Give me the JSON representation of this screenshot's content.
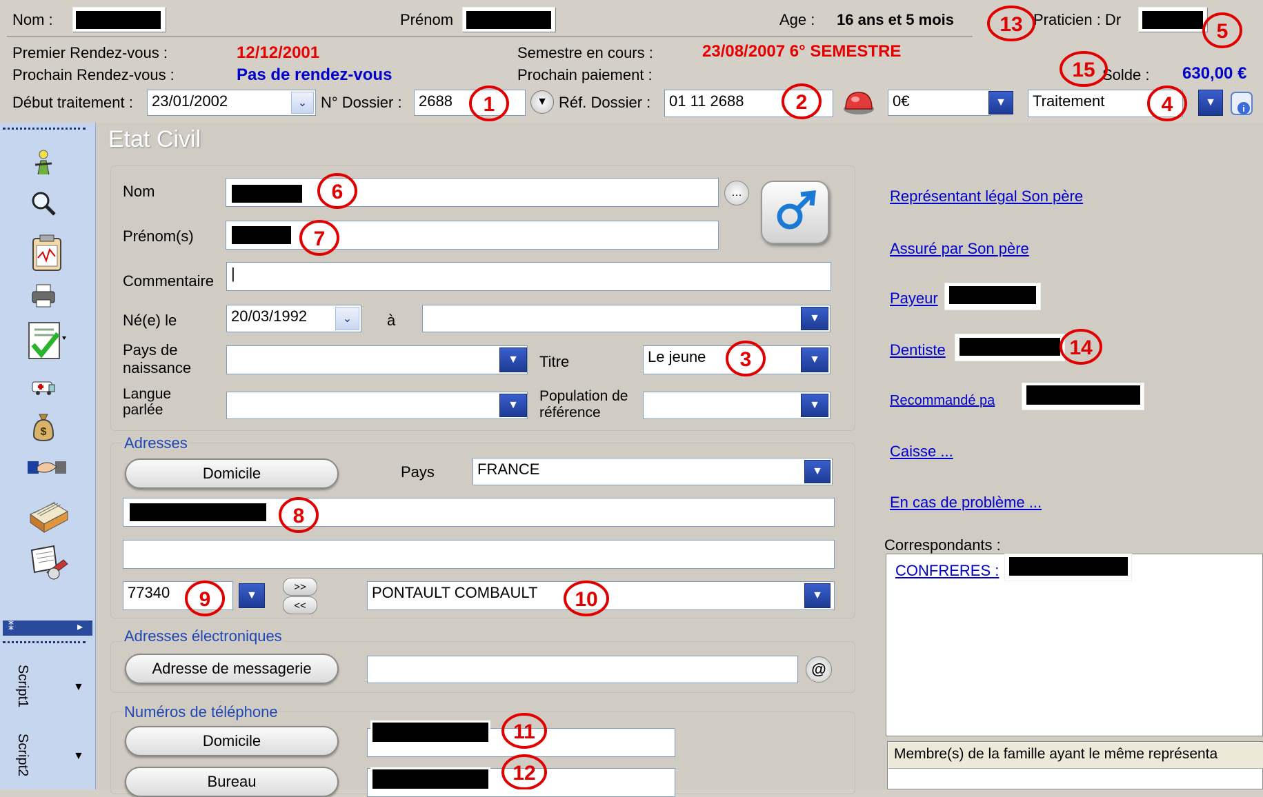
{
  "header": {
    "nom_label": "Nom :",
    "prenom_label": "Prénom",
    "age_label": "Age :",
    "age_value": "16 ans et  5 mois",
    "praticien_label": "Praticien : Dr",
    "premier_rdv_label": "Premier Rendez-vous :",
    "premier_rdv_value": "12/12/2001",
    "prochain_rdv_label": "Prochain Rendez-vous :",
    "prochain_rdv_value": "Pas de rendez-vous",
    "semestre_label": "Semestre en cours :",
    "semestre_value": "23/08/2007 6° SEMESTRE",
    "prochain_paiement_label": "Prochain paiement :",
    "solde_label": "Solde :",
    "solde_value": "630,00 €",
    "debut_label": "Début traitement :",
    "debut_value": "23/01/2002",
    "dossier_label": "N° Dossier :",
    "dossier_value": "2688",
    "ref_label": "Réf. Dossier :",
    "ref_value": "01 11 2688",
    "amount_value": "0€",
    "status_value": "Traitement"
  },
  "sidebar": {
    "icons": [
      "person-icon",
      "magnifier-icon",
      "clipboard-chart-icon",
      "printer-icon",
      "checklist-icon",
      "ambulance-icon",
      "money-bag-icon",
      "handshake-icon",
      "card-file-icon",
      "mail-icon"
    ],
    "script1": "Script1",
    "script2": "Script2"
  },
  "etat_civil": {
    "title": "Etat Civil",
    "nom_label": "Nom",
    "prenom_label": "Prénom(s)",
    "commentaire_label": "Commentaire",
    "commentaire_value": "|",
    "ne_le_label": "Né(e) le",
    "ne_le_value": "20/03/1992",
    "a_label": "à",
    "pays_naissance_label_1": "Pays de",
    "pays_naissance_label_2": "naissance",
    "titre_label": "Titre",
    "titre_value": "Le jeune",
    "langue_label_1": "Langue",
    "langue_label_2": "parlée",
    "population_label_1": "Population de",
    "population_label_2": "référence"
  },
  "adresses": {
    "title": "Adresses",
    "domicile_button": "Domicile",
    "pays_label": "Pays",
    "pays_value": "FRANCE",
    "cp_value": "77340",
    "ville_value": "PONTAULT COMBAULT",
    "arrows_top": ">>",
    "arrows_bottom": "<<"
  },
  "electroniques": {
    "title": "Adresses électroniques",
    "messagerie_button": "Adresse de messagerie"
  },
  "telephones": {
    "title": "Numéros de téléphone",
    "domicile_button": "Domicile",
    "bureau_button": "Bureau"
  },
  "right": {
    "representant_link": "Représentant légal Son père",
    "assure_link": "Assuré par Son père",
    "payeur_link": "Payeur",
    "dentiste_link": "Dentiste",
    "recommande_link": "Recommandé pa",
    "caisse_link": "Caisse ...",
    "probleme_link": "En cas de problème ...",
    "correspondants_label": "Correspondants :",
    "confreres_link": "CONFRERES :",
    "membres_label": "Membre(s) de la famille ayant le même représenta"
  },
  "badges": [
    "1",
    "2",
    "3",
    "4",
    "5",
    "6",
    "7",
    "8",
    "9",
    "10",
    "11",
    "12",
    "13",
    "14",
    "15"
  ],
  "colors": {
    "background": "#d4d0c8",
    "panel": "#d0ccc4",
    "sidebar": "#c6d6ef",
    "red_value": "#e60000",
    "blue_value": "#0000cc",
    "badge_red": "#e00000"
  }
}
